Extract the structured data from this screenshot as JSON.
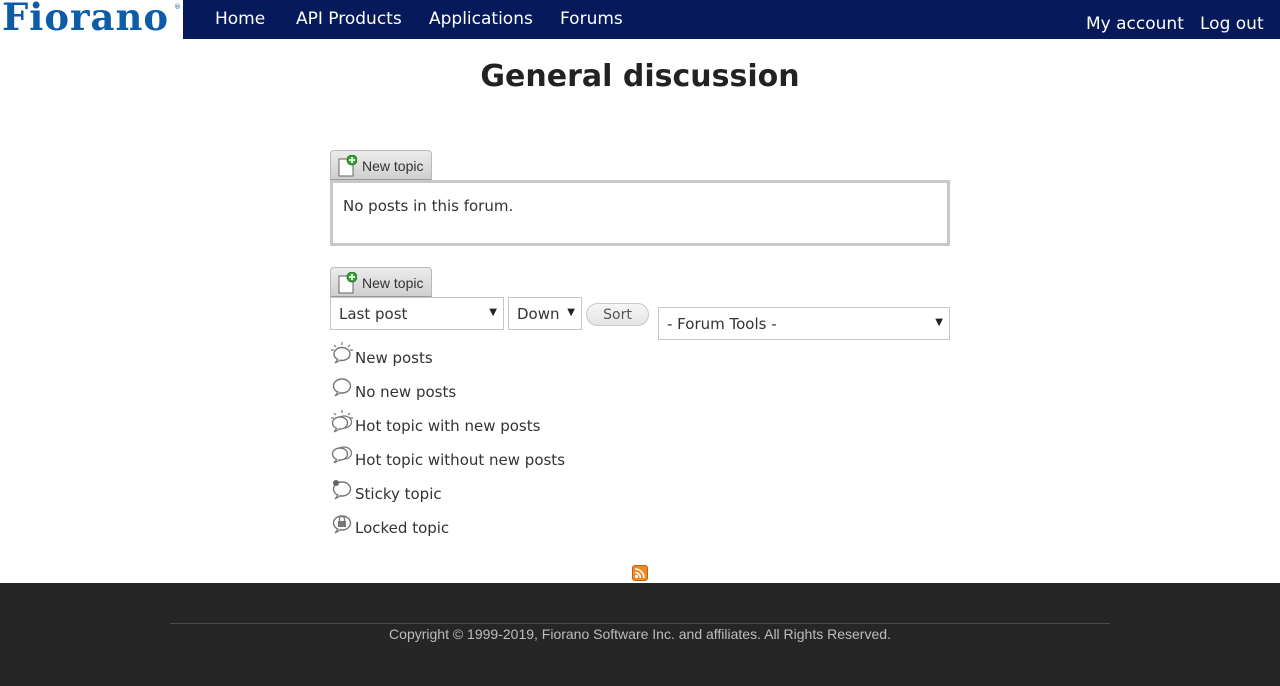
{
  "header": {
    "logo": "Fiorano",
    "logo_mark": "®",
    "nav": [
      "Home",
      "API Products",
      "Applications",
      "Forums"
    ],
    "account": "My account",
    "logout": "Log out"
  },
  "page": {
    "title": "General discussion",
    "new_topic_label": "New topic",
    "empty_message": "No posts in this forum."
  },
  "controls": {
    "sort_by": "Last post",
    "sort_order": "Down",
    "sort_button": "Sort",
    "forum_tools": "- Forum Tools -"
  },
  "legend": [
    {
      "icon": "new-posts-icon",
      "label": "New posts"
    },
    {
      "icon": "no-new-posts-icon",
      "label": "No new posts"
    },
    {
      "icon": "hot-topic-new-posts-icon",
      "label": "Hot topic with new posts"
    },
    {
      "icon": "hot-topic-no-new-posts-icon",
      "label": "Hot topic without new posts"
    },
    {
      "icon": "sticky-topic-icon",
      "label": "Sticky topic"
    },
    {
      "icon": "locked-topic-icon",
      "label": "Locked topic"
    }
  ],
  "footer": {
    "copyright": "Copyright © 1999-2019, Fiorano Software Inc. and affiliates. All Rights Reserved."
  },
  "colors": {
    "nav_bg": "#06195a",
    "logo": "#0c5ca8",
    "footer_bg": "#262626",
    "rss": "#f08a24",
    "new_topic_plus": "#2fa52f"
  }
}
